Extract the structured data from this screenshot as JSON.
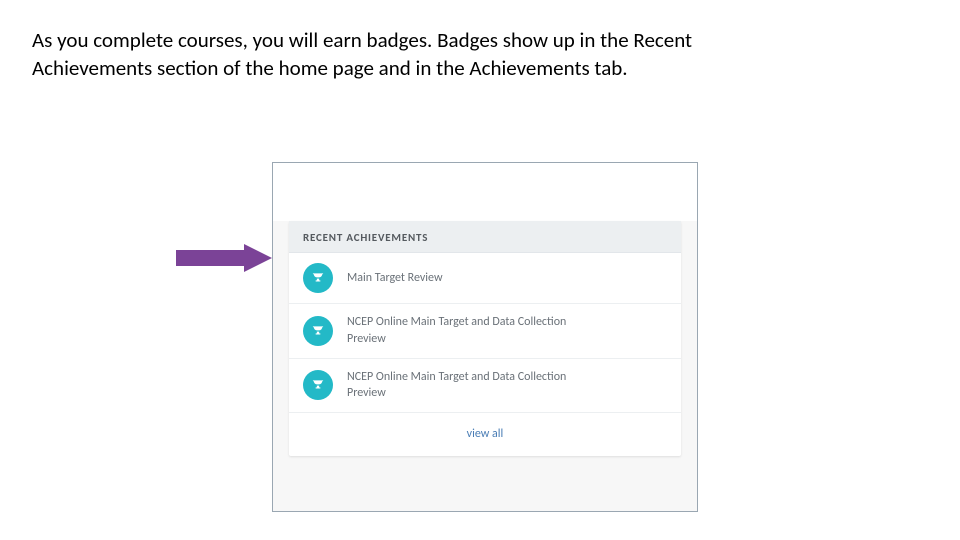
{
  "body_text": "As you complete courses, you will earn badges. Badges show up in the Recent Achievements section of the home page and in the Achievements tab.",
  "panel": {
    "header": "RECENT ACHIEVEMENTS",
    "items": [
      {
        "title": "Main Target Review"
      },
      {
        "title": "NCEP Online Main Target and Data Collection Preview"
      },
      {
        "title": "NCEP Online Main Target and Data Collection Preview"
      }
    ],
    "view_all": "view all"
  },
  "colors": {
    "arrow": "#7b4397",
    "badge": "#23b9c7",
    "link": "#4a7db5"
  }
}
